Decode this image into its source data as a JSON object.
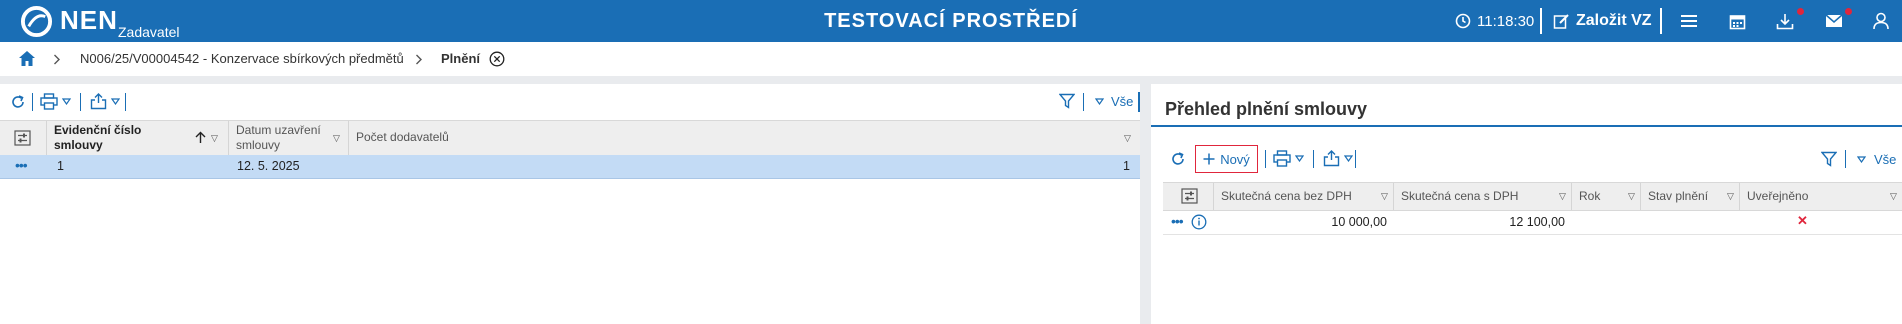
{
  "header": {
    "brand": "NEN",
    "brand_sub": "Zadavatel",
    "environment": "TESTOVACÍ PROSTŘEDÍ",
    "clock": "11:18:30",
    "create_label": "Založit VZ"
  },
  "breadcrumb": {
    "items": [
      "N006/25/V00004542 - Konzervace sbírkových předmětů",
      "Plnění"
    ]
  },
  "left_table": {
    "filter_all_label": "Vše",
    "columns": [
      "Evidenční číslo smlouvy",
      "Datum uzavření smlouvy",
      "Počet dodavatelů"
    ],
    "rows": [
      {
        "evidencni_cislo": "1",
        "datum": "12. 5. 2025",
        "pocet": "1"
      }
    ]
  },
  "right_panel": {
    "title": "Přehled plnění smlouvy",
    "new_label": "Nový",
    "filter_all_label": "Vše",
    "columns": [
      "Skutečná cena bez DPH",
      "Skutečná cena s DPH",
      "Rok",
      "Stav plnění",
      "Uveřejněno"
    ],
    "rows": [
      {
        "cena_bez": "10 000,00",
        "cena_s": "12 100,00",
        "rok": "",
        "stav": "",
        "uverejneno": "✕"
      }
    ]
  },
  "colors": {
    "brand_blue": "#1a6eb5",
    "row_selected": "#c3dbf5",
    "alert_red": "#e0263c",
    "highlight_border": "#e0263c"
  }
}
